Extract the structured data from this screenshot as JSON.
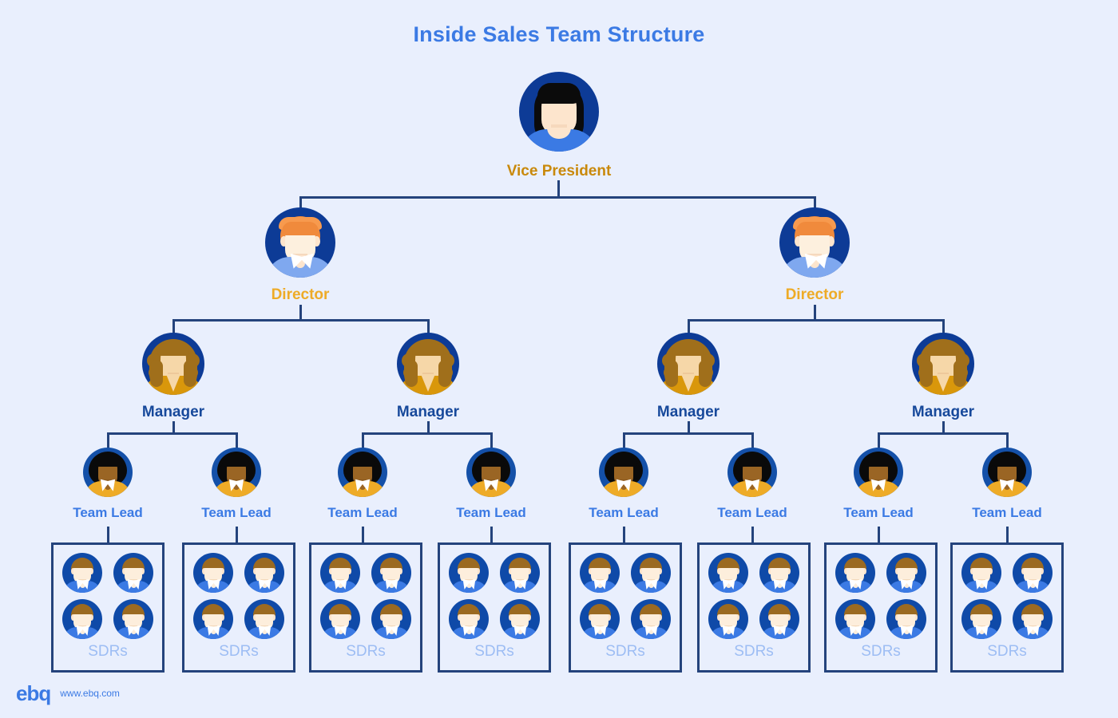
{
  "title": "Inside Sales Team Structure",
  "theme": {
    "background": "#e9effd",
    "title_color": "#3b7ae4",
    "line_color": "#24437c",
    "vp_label_color": "#c9890b",
    "director_label_color": "#eeab27",
    "manager_label_color": "#17499b",
    "team_lead_label_color": "#3b7ae4",
    "sdr_label_color": "#9dbdf4",
    "avatar_circle_color": "#0d3b96"
  },
  "chart_data": {
    "type": "diagram",
    "diagram_kind": "organizational-hierarchy",
    "title": "Inside Sales Team Structure",
    "levels": [
      {
        "level": 1,
        "role": "Vice President",
        "count": 1
      },
      {
        "level": 2,
        "role": "Director",
        "count": 2
      },
      {
        "level": 3,
        "role": "Manager",
        "count": 4
      },
      {
        "level": 4,
        "role": "Team Lead",
        "count": 8
      },
      {
        "level": 5,
        "role": "SDRs",
        "count": 8,
        "members_per_group": 4
      }
    ]
  },
  "nodes": {
    "vice_president": {
      "label": "Vice President",
      "avatar": "female-dark-bob-avatar-icon"
    },
    "directors": [
      {
        "label": "Director",
        "avatar": "male-ginger-avatar-icon"
      },
      {
        "label": "Director",
        "avatar": "male-ginger-avatar-icon"
      }
    ],
    "managers": [
      {
        "label": "Manager",
        "avatar": "female-brown-wavy-avatar-icon"
      },
      {
        "label": "Manager",
        "avatar": "female-brown-wavy-avatar-icon"
      },
      {
        "label": "Manager",
        "avatar": "female-brown-wavy-avatar-icon"
      },
      {
        "label": "Manager",
        "avatar": "female-brown-wavy-avatar-icon"
      }
    ],
    "team_leads": [
      {
        "label": "Team Lead",
        "avatar": "person-afro-avatar-icon"
      },
      {
        "label": "Team Lead",
        "avatar": "person-afro-avatar-icon"
      },
      {
        "label": "Team Lead",
        "avatar": "person-afro-avatar-icon"
      },
      {
        "label": "Team Lead",
        "avatar": "person-afro-avatar-icon"
      },
      {
        "label": "Team Lead",
        "avatar": "person-afro-avatar-icon"
      },
      {
        "label": "Team Lead",
        "avatar": "person-afro-avatar-icon"
      },
      {
        "label": "Team Lead",
        "avatar": "person-afro-avatar-icon"
      },
      {
        "label": "Team Lead",
        "avatar": "person-afro-avatar-icon"
      }
    ],
    "sdr_groups": [
      {
        "label": "SDRs",
        "members": 4
      },
      {
        "label": "SDRs",
        "members": 4
      },
      {
        "label": "SDRs",
        "members": 4
      },
      {
        "label": "SDRs",
        "members": 4
      },
      {
        "label": "SDRs",
        "members": 4
      },
      {
        "label": "SDRs",
        "members": 4
      },
      {
        "label": "SDRs",
        "members": 4
      },
      {
        "label": "SDRs",
        "members": 4
      }
    ]
  },
  "footer": {
    "logo_text": "ebq",
    "website": "www.ebq.com"
  }
}
